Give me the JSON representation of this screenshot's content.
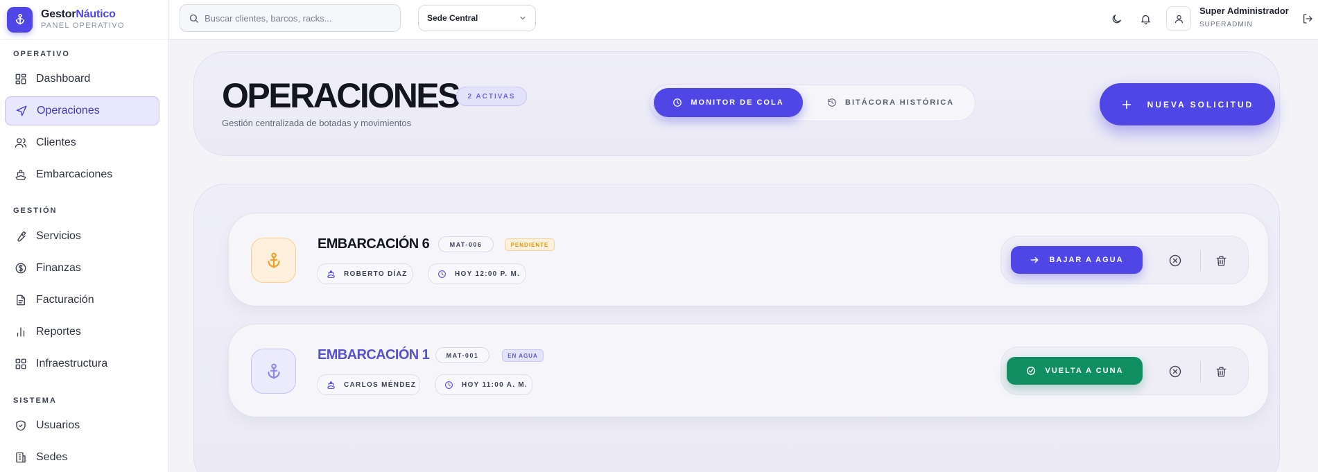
{
  "brand": {
    "name_primary": "Gestor",
    "name_accent": "Náutico",
    "subtitle": "PANEL OPERATIVO"
  },
  "sidebar": {
    "sections": [
      {
        "title": "OPERATIVO"
      },
      {
        "title": "GESTIÓN"
      },
      {
        "title": "SISTEMA"
      }
    ],
    "items": [
      {
        "label": "Dashboard",
        "icon": "dashboard-icon"
      },
      {
        "label": "Operaciones",
        "icon": "send-icon",
        "active": true
      },
      {
        "label": "Clientes",
        "icon": "users-icon"
      },
      {
        "label": "Embarcaciones",
        "icon": "ship-icon"
      },
      {
        "label": "Servicios",
        "icon": "wrench-icon"
      },
      {
        "label": "Finanzas",
        "icon": "dollar-icon"
      },
      {
        "label": "Facturación",
        "icon": "document-icon"
      },
      {
        "label": "Reportes",
        "icon": "bar-chart-icon"
      },
      {
        "label": "Infraestructura",
        "icon": "grid-icon"
      },
      {
        "label": "Usuarios",
        "icon": "shield-icon"
      },
      {
        "label": "Sedes",
        "icon": "building-icon"
      }
    ]
  },
  "topbar": {
    "search_placeholder": "Buscar clientes, barcos, racks...",
    "site": "Sede Central",
    "user_name": "Super Administrador",
    "user_role": "SUPERADMIN"
  },
  "hero": {
    "title": "OPERACIONES",
    "badge": "2 ACTIVAS",
    "subtitle": "Gestión centralizada de botadas y movimientos",
    "tab_monitor": "MONITOR DE COLA",
    "tab_history": "BITÁCORA HISTÓRICA",
    "new_request": "NUEVA SOLICITUD"
  },
  "requests": [
    {
      "boat": "EMBARCACIÓN 6",
      "mat": "MAT-006",
      "status": "PENDIENTE",
      "client": "ROBERTO DÍAZ",
      "time": "HOY 12:00 P. M.",
      "action": "BAJAR A AGUA"
    },
    {
      "boat": "EMBARCACIÓN 1",
      "mat": "MAT-001",
      "status": "EN AGUA",
      "client": "CARLOS MÉNDEZ",
      "time": "HOY 11:00 A. M.",
      "action": "VUELTA A CUNA"
    }
  ],
  "colors": {
    "accent": "#4f46e5",
    "success": "#0f8f62",
    "pending": "#e8940f"
  }
}
